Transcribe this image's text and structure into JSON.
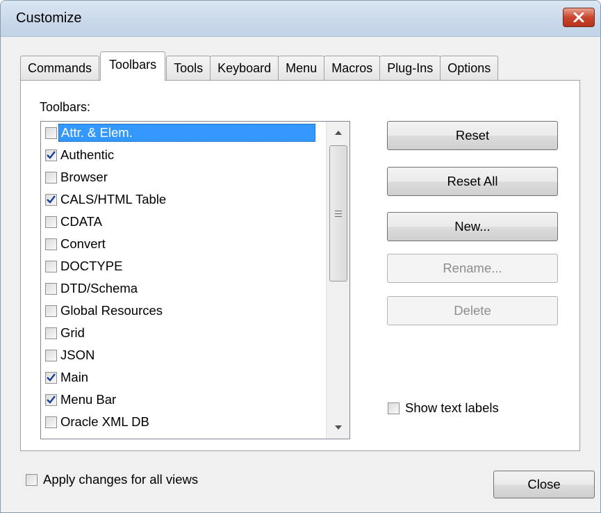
{
  "window": {
    "title": "Customize"
  },
  "tabs": [
    {
      "label": "Commands",
      "active": false
    },
    {
      "label": "Toolbars",
      "active": true
    },
    {
      "label": "Tools",
      "active": false
    },
    {
      "label": "Keyboard",
      "active": false
    },
    {
      "label": "Menu",
      "active": false
    },
    {
      "label": "Macros",
      "active": false
    },
    {
      "label": "Plug-Ins",
      "active": false
    },
    {
      "label": "Options",
      "active": false
    }
  ],
  "toolbars_panel": {
    "label": "Toolbars:",
    "items": [
      {
        "label": "Attr. & Elem.",
        "checked": false,
        "selected": true
      },
      {
        "label": "Authentic",
        "checked": true,
        "selected": false
      },
      {
        "label": "Browser",
        "checked": false,
        "selected": false
      },
      {
        "label": "CALS/HTML Table",
        "checked": true,
        "selected": false
      },
      {
        "label": "CDATA",
        "checked": false,
        "selected": false
      },
      {
        "label": "Convert",
        "checked": false,
        "selected": false
      },
      {
        "label": "DOCTYPE",
        "checked": false,
        "selected": false
      },
      {
        "label": "DTD/Schema",
        "checked": false,
        "selected": false
      },
      {
        "label": "Global Resources",
        "checked": false,
        "selected": false
      },
      {
        "label": "Grid",
        "checked": false,
        "selected": false
      },
      {
        "label": "JSON",
        "checked": false,
        "selected": false
      },
      {
        "label": "Main",
        "checked": true,
        "selected": false
      },
      {
        "label": "Menu Bar",
        "checked": true,
        "selected": false
      },
      {
        "label": "Oracle XML DB",
        "checked": false,
        "selected": false
      }
    ]
  },
  "buttons": {
    "reset": "Reset",
    "reset_all": "Reset All",
    "new": "New...",
    "rename": "Rename...",
    "delete": "Delete"
  },
  "show_text_labels": {
    "label": "Show text labels",
    "checked": false
  },
  "apply_all_views": {
    "label": "Apply changes for all views",
    "checked": false
  },
  "close_label": "Close",
  "colors": {
    "selection": "#3399ff",
    "close_button": "#c9452d",
    "checkmark": "#1c3f94"
  }
}
